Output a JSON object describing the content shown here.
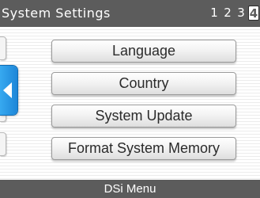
{
  "header": {
    "title": "System Settings",
    "pages": [
      "1",
      "2",
      "3",
      "4"
    ],
    "current_page": "4"
  },
  "back_button": {
    "icon": "left-arrow-icon",
    "color": "#2a97e6"
  },
  "menu": {
    "items": [
      {
        "label": "Language"
      },
      {
        "label": "Country"
      },
      {
        "label": "System Update"
      },
      {
        "label": "Format System Memory"
      }
    ]
  },
  "footer": {
    "label": "DSi Menu"
  },
  "colors": {
    "bar": "#5c5c5c",
    "accent": "#2a97e6",
    "button_text": "#2b2b2b"
  }
}
